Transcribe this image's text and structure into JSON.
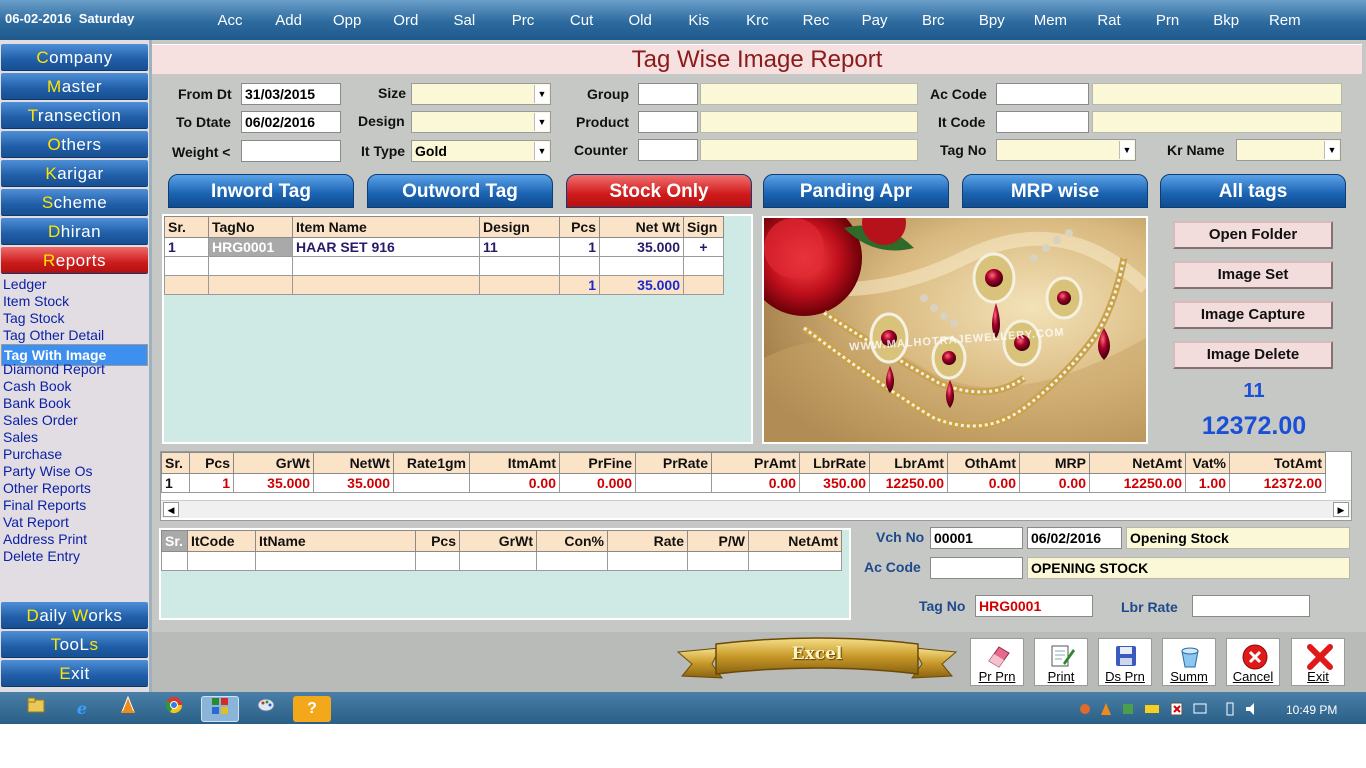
{
  "topbar": {
    "date": "06-02-2016",
    "day": "Saturday",
    "menu": [
      "Acc",
      "Add",
      "Opp",
      "Ord",
      "Sal",
      "Prc",
      "Cut",
      "Old",
      "Kis",
      "Krc",
      "Rec",
      "Pay",
      "Brc",
      "Bpy",
      "Mem",
      "Rat",
      "Prn",
      "Bkp",
      "Rem"
    ]
  },
  "sidebar": {
    "top_buttons": [
      {
        "cap": "C",
        "rest": "ompany"
      },
      {
        "cap": "M",
        "rest": "aster"
      },
      {
        "cap": "T",
        "rest": "ransection"
      },
      {
        "cap": "O",
        "rest": "thers"
      },
      {
        "cap": "K",
        "rest": "arigar"
      },
      {
        "cap": "S",
        "rest": "cheme"
      },
      {
        "cap": "D",
        "rest": "hiran"
      },
      {
        "cap": "R",
        "rest": "eports"
      }
    ],
    "report_items": [
      "Ledger",
      "Item Stock",
      "Tag Stock",
      "Tag Other Detail",
      "Tag With Image",
      "Diamond Report",
      "Cash Book",
      "Bank Book",
      "Sales Order",
      "Sales",
      "Purchase",
      "Party Wise Os",
      "Other Reports",
      "Final Reports",
      "Vat Report",
      "Address Print",
      "Delete Entry"
    ],
    "selected_item": "Tag With Image",
    "bottom_buttons": [
      {
        "cap": "D",
        "rest": "aily ",
        "cap2": "W",
        "rest2": "orks"
      },
      {
        "cap": "T",
        "rest": "ooL",
        "cap2": "s",
        "rest2": ""
      },
      {
        "cap": "E",
        "rest": "xit",
        "cap2": "",
        "rest2": ""
      }
    ]
  },
  "title": "Tag Wise Image Report",
  "filters": {
    "from_dt_label": "From Dt",
    "from_dt": "31/03/2015",
    "to_dt_label": "To Dtate",
    "to_dt": "06/02/2016",
    "weight_label": "Weight <",
    "weight": "",
    "size_label": "Size",
    "size": "",
    "design_label": "Design",
    "design": "",
    "it_type_label": "It Type",
    "it_type": "Gold",
    "group_label": "Group",
    "product_label": "Product",
    "counter_label": "Counter",
    "ac_code_label": "Ac Code",
    "it_code_label": "It Code",
    "tag_no_label": "Tag No",
    "kr_name_label": "Kr Name"
  },
  "tabs": [
    "Inword Tag",
    "Outword Tag",
    "Stock Only",
    "Panding Apr",
    "MRP wise",
    "All tags"
  ],
  "active_tab": "Stock Only",
  "tag_grid": {
    "headers": [
      "Sr.",
      "TagNo",
      "Item Name",
      "Design",
      "Pcs",
      "Net Wt",
      "Sign"
    ],
    "rows": [
      [
        "1",
        "HRG0001",
        "HAAR SET 916",
        "11",
        "1",
        "35.000",
        "+"
      ]
    ],
    "total": {
      "pcs": "1",
      "net_wt": "35.000"
    }
  },
  "image": {
    "watermark": "WWW.MALHOTRAJEWELLERY.COM"
  },
  "side_buttons": [
    "Open Folder",
    "Image Set",
    "Image Capture",
    "Image Delete"
  ],
  "design_value": "11",
  "amount_value": "12372.00",
  "detail_grid": {
    "headers": [
      "Sr.",
      "Pcs",
      "GrWt",
      "NetWt",
      "Rate1gm",
      "ItmAmt",
      "PrFine",
      "PrRate",
      "PrAmt",
      "LbrRate",
      "LbrAmt",
      "OthAmt",
      "MRP",
      "NetAmt",
      "Vat%",
      "TotAmt"
    ],
    "rows": [
      [
        "1",
        "1",
        "35.000",
        "35.000",
        "",
        "0.00",
        "0.000",
        "",
        "0.00",
        "350.00",
        "12250.00",
        "0.00",
        "0.00",
        "12250.00",
        "1.00",
        "12372.00"
      ]
    ]
  },
  "item_grid": {
    "headers": [
      "Sr.",
      "ItCode",
      "ItName",
      "Pcs",
      "GrWt",
      "Con%",
      "Rate",
      "P/W",
      "NetAmt"
    ]
  },
  "voucher": {
    "vch_no_label": "Vch No",
    "vch_no": "00001",
    "vch_date": "06/02/2016",
    "vch_type": "Opening Stock",
    "ac_code_label": "Ac Code",
    "ac_code": "",
    "ac_name": "OPENING STOCK",
    "tag_no_label": "Tag No",
    "tag_no": "HRG0001",
    "lbr_rate_label": "Lbr Rate",
    "lbr_rate": ""
  },
  "excel_label": "Excel",
  "action_buttons": [
    {
      "label": "Pr Prn",
      "icon": "eraser-icon"
    },
    {
      "label": "Print",
      "icon": "print-pen-icon"
    },
    {
      "label": "Ds Prn",
      "icon": "floppy-icon"
    },
    {
      "label": "Summ",
      "icon": "bucket-icon"
    },
    {
      "label": "Cancel",
      "icon": "cancel-icon"
    },
    {
      "label": "Exit",
      "icon": "exit-x-icon"
    }
  ],
  "taskbar": {
    "clock": "10:49 PM"
  },
  "colors": {
    "active_tab": "#d01a1a",
    "tab": "#1a62b0",
    "design_value": "#1a4fd8",
    "tag_no": "#d40000"
  }
}
